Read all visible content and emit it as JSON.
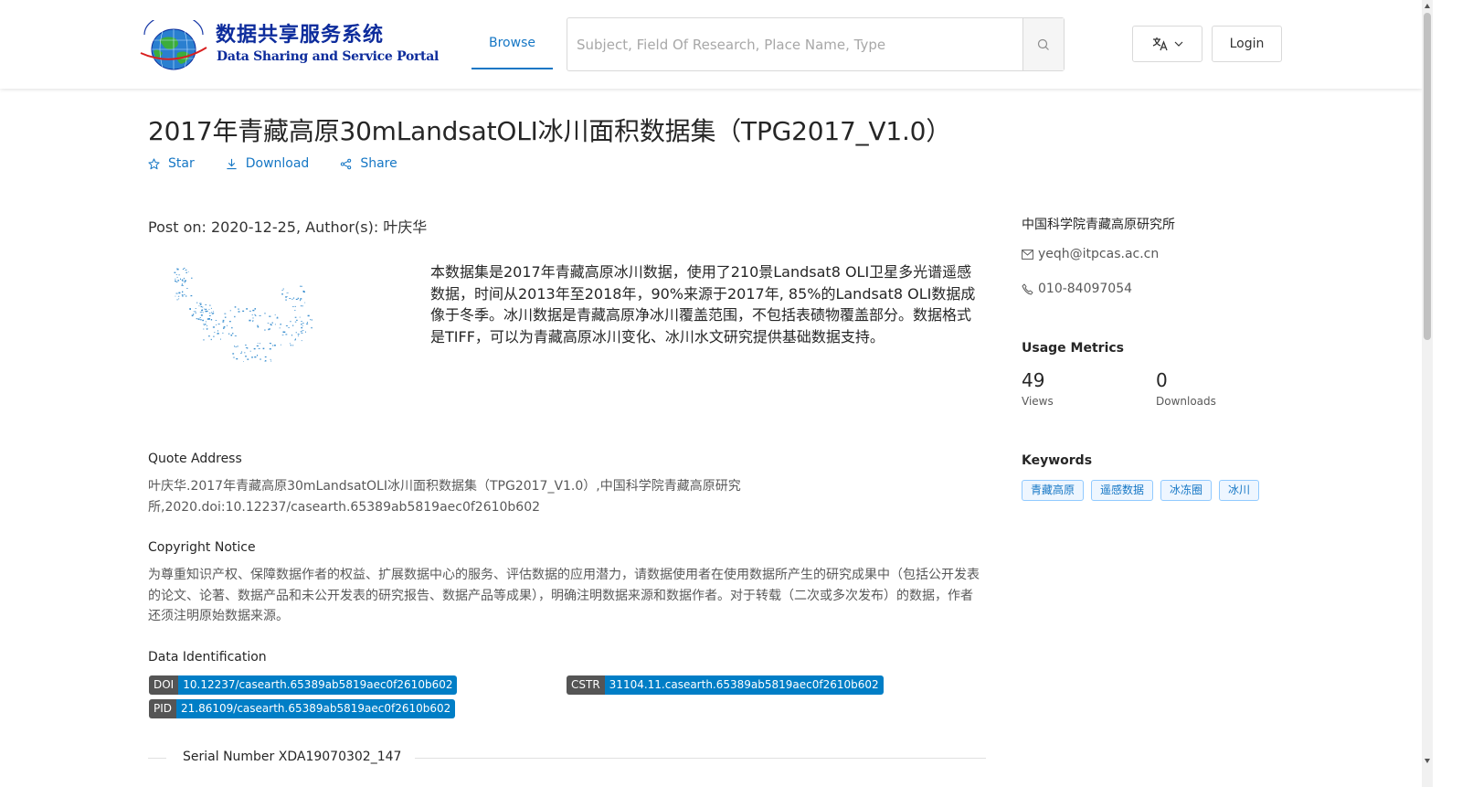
{
  "header": {
    "logo_cn": "数据共享服务系统",
    "logo_en": "Data Sharing and Service Portal",
    "nav_browse": "Browse",
    "search_placeholder": "Subject, Field Of Research, Place Name, Type",
    "login": "Login"
  },
  "dataset": {
    "title": "2017年青藏高原30mLandsatOLI冰川面积数据集（TPG2017_V1.0）",
    "actions": {
      "star": "Star",
      "download": "Download",
      "share": "Share"
    },
    "post_meta": "Post on: 2020-12-25, Author(s): 叶庆华",
    "abstract": "本数据集是2017年青藏高原冰川数据，使用了210景Landsat8 OLI卫星多光谱遥感数据，时间从2013年至2018年，90%来源于2017年, 85%的Landsat8 OLI数据成像于冬季。冰川数据是青藏高原净冰川覆盖范围，不包括表碛物覆盖部分。数据格式是TIFF，可以为青藏高原冰川变化、冰川水文研究提供基础数据支持。"
  },
  "quote": {
    "title": "Quote Address",
    "text": "叶庆华.2017年青藏高原30mLandsatOLI冰川面积数据集（TPG2017_V1.0）,中国科学院青藏高原研究所,2020.doi:10.12237/casearth.65389ab5819aec0f2610b602"
  },
  "copyright": {
    "title": "Copyright Notice",
    "text": "为尊重知识产权、保障数据作者的权益、扩展数据中心的服务、评估数据的应用潜力，请数据使用者在使用数据所产生的研究成果中（包括公开发表的论文、论著、数据产品和未公开发表的研究报告、数据产品等成果），明确注明数据来源和数据作者。对于转载（二次或多次发布）的数据，作者还须注明原始数据来源。"
  },
  "identification": {
    "title": "Data Identification",
    "doi_key": "DOI",
    "doi_val": "10.12237/casearth.65389ab5819aec0f2610b602",
    "cstr_key": "CSTR",
    "cstr_val": "31104.11.casearth.65389ab5819aec0f2610b602",
    "pid_key": "PID",
    "pid_val": "21.86109/casearth.65389ab5819aec0f2610b602"
  },
  "serial": "Serial Number XDA19070302_147",
  "sidebar": {
    "org": "中国科学院青藏高原研究所",
    "email": "yeqh@itpcas.ac.cn",
    "phone": "010-84097054",
    "metrics_title": "Usage Metrics",
    "views_num": "49",
    "views_label": "Views",
    "downloads_num": "0",
    "downloads_label": "Downloads",
    "keywords_title": "Keywords",
    "keywords": [
      "青藏高原",
      "遥感数据",
      "冰冻圈",
      "冰川"
    ]
  },
  "colors": {
    "link": "#1677c5",
    "badge_key": "#555555",
    "badge_val": "#007ec6"
  }
}
